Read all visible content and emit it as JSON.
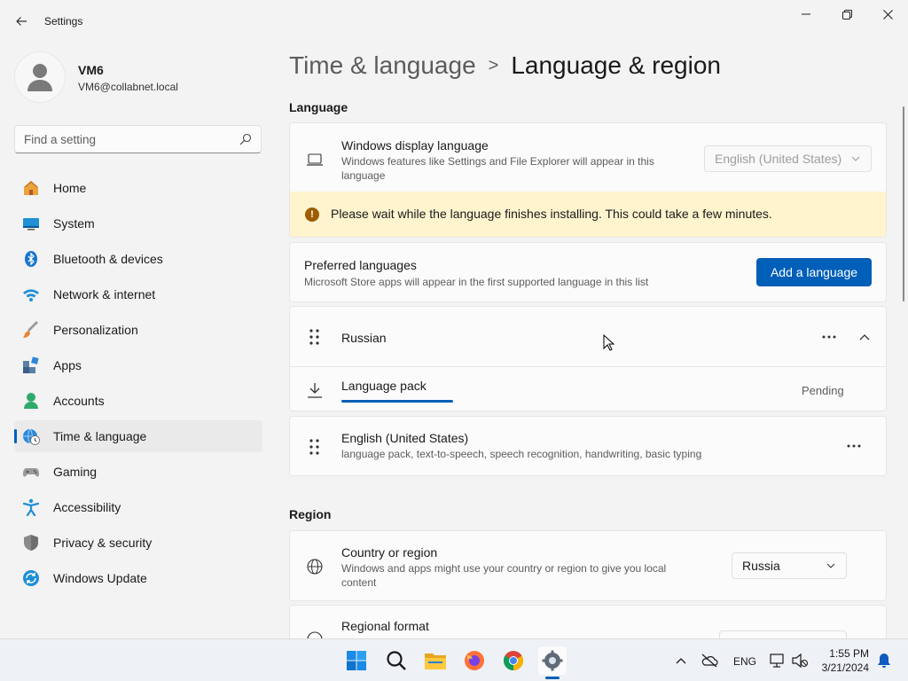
{
  "window": {
    "title": "Settings"
  },
  "profile": {
    "name": "VM6",
    "email": "VM6@collabnet.local"
  },
  "search": {
    "placeholder": "Find a setting"
  },
  "sidebar": {
    "items": [
      {
        "label": "Home",
        "icon": "home-icon"
      },
      {
        "label": "System",
        "icon": "system-icon"
      },
      {
        "label": "Bluetooth & devices",
        "icon": "bluetooth-icon"
      },
      {
        "label": "Network & internet",
        "icon": "wifi-icon"
      },
      {
        "label": "Personalization",
        "icon": "brush-icon"
      },
      {
        "label": "Apps",
        "icon": "apps-icon"
      },
      {
        "label": "Accounts",
        "icon": "accounts-icon"
      },
      {
        "label": "Time & language",
        "icon": "time-language-icon",
        "selected": true
      },
      {
        "label": "Gaming",
        "icon": "gaming-icon"
      },
      {
        "label": "Accessibility",
        "icon": "accessibility-icon"
      },
      {
        "label": "Privacy & security",
        "icon": "shield-icon"
      },
      {
        "label": "Windows Update",
        "icon": "update-icon"
      }
    ]
  },
  "breadcrumb": {
    "parent": "Time & language",
    "separator": ">",
    "current": "Language & region"
  },
  "language_section": {
    "title": "Language",
    "display_language": {
      "title": "Windows display language",
      "description_line1": "Windows features like Settings and File Explorer will appear in this",
      "description_line2": "language",
      "value": "English (United States)"
    },
    "warning": "Please wait while the language finishes installing. This could take a few minutes.",
    "preferred": {
      "title": "Preferred languages",
      "description": "Microsoft Store apps will appear in the first supported language in this list",
      "add_button": "Add a language"
    },
    "languages": [
      {
        "name": "Russian",
        "expanded": true,
        "feature": {
          "name": "Language pack",
          "status": "Pending",
          "progress": 0.2
        }
      },
      {
        "name": "English (United States)",
        "description": "language pack, text-to-speech, speech recognition, handwriting, basic typing"
      }
    ]
  },
  "region_section": {
    "title": "Region",
    "country": {
      "title": "Country or region",
      "description_line1": "Windows and apps might use your country or region to give you local",
      "description_line2": "content",
      "value": "Russia"
    },
    "format": {
      "title": "Regional format"
    }
  },
  "taskbar": {
    "apps": [
      "start-icon",
      "search-icon",
      "file-explorer-icon",
      "firefox-icon",
      "chrome-icon",
      "settings-icon"
    ],
    "active_app": "settings-icon",
    "input_language": "ENG",
    "time": "1:55 PM",
    "date": "3/21/2024"
  },
  "colors": {
    "accent": "#005fb8",
    "warning_bg": "#fff4ce",
    "warning_icon": "#9d5d00"
  }
}
